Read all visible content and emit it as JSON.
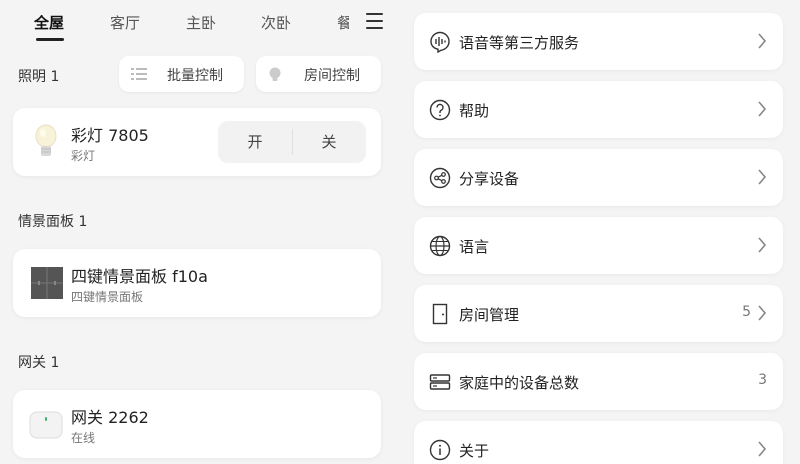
{
  "tabs": [
    {
      "label": "全屋",
      "active": true
    },
    {
      "label": "客厅",
      "active": false
    },
    {
      "label": "主卧",
      "active": false
    },
    {
      "label": "次卧",
      "active": false
    },
    {
      "label": "餐",
      "active": false
    }
  ],
  "lighting": {
    "title": "照明 1",
    "batch_label": "批量控制",
    "room_label": "房间控制",
    "device": {
      "name": "彩灯 7805",
      "type": "彩灯",
      "on_label": "开",
      "off_label": "关"
    }
  },
  "scene": {
    "title": "情景面板 1",
    "device": {
      "name": "四键情景面板 f10a",
      "type": "四键情景面板"
    }
  },
  "gateway": {
    "title": "网关 1",
    "device": {
      "name": "网关 2262",
      "status": "在线"
    }
  },
  "settings": [
    {
      "label": "语音等第三方服务",
      "value": "",
      "chevron": true,
      "icon": "voice-icon"
    },
    {
      "label": "帮助",
      "value": "",
      "chevron": true,
      "icon": "help-icon"
    },
    {
      "label": "分享设备",
      "value": "",
      "chevron": true,
      "icon": "share-icon"
    },
    {
      "label": "语言",
      "value": "",
      "chevron": true,
      "icon": "globe-icon"
    },
    {
      "label": "房间管理",
      "value": "5",
      "chevron": true,
      "icon": "door-icon"
    },
    {
      "label": "家庭中的设备总数",
      "value": "3",
      "chevron": false,
      "icon": "devices-icon"
    },
    {
      "label": "关于",
      "value": "",
      "chevron": true,
      "icon": "info-icon"
    }
  ],
  "colors": {
    "background": "#f4f4f4",
    "card": "#ffffff",
    "text": "#222222",
    "muted": "#777777"
  }
}
